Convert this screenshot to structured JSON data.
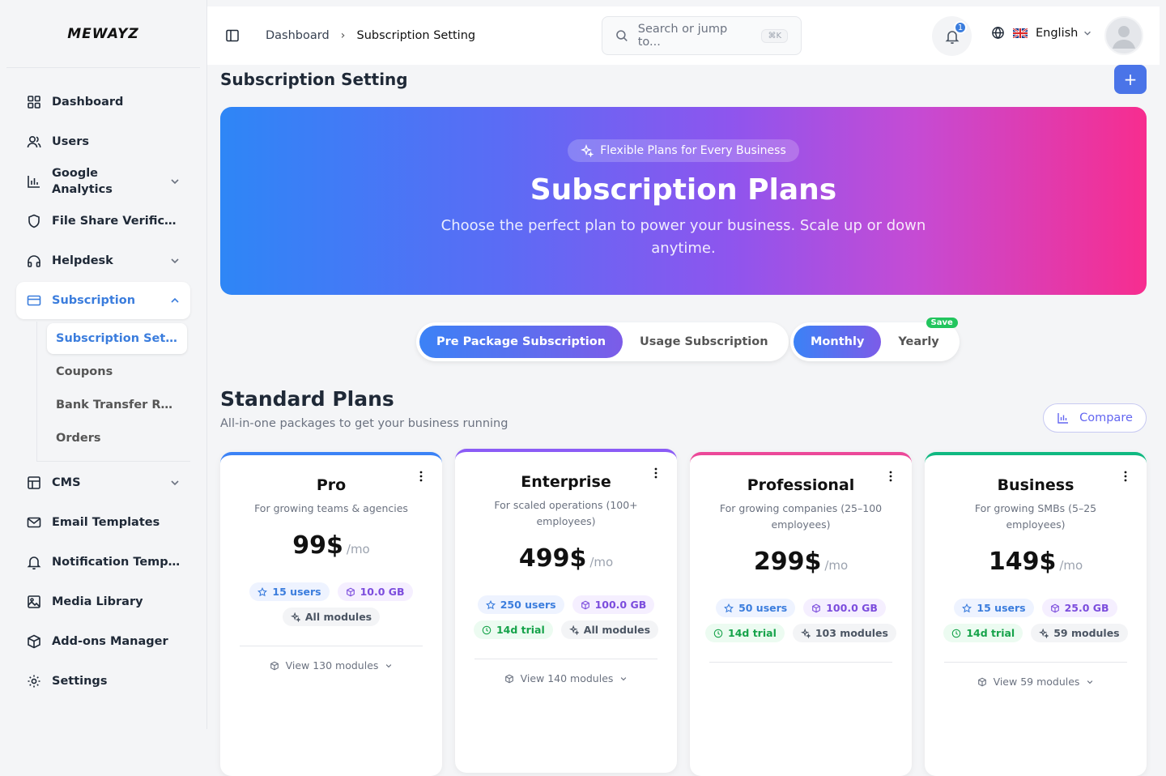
{
  "brand": {
    "logo": "MEWAYZ"
  },
  "sidebar": {
    "items": [
      {
        "label": "Dashboard"
      },
      {
        "label": "Users"
      },
      {
        "label": "Google Analytics"
      },
      {
        "label": "File Share Verifica..."
      },
      {
        "label": "Helpdesk"
      },
      {
        "label": "Subscription"
      },
      {
        "label": "CMS"
      },
      {
        "label": "Email Templates"
      },
      {
        "label": "Notification Templ..."
      },
      {
        "label": "Media Library"
      },
      {
        "label": "Add-ons Manager"
      },
      {
        "label": "Settings"
      }
    ],
    "sub_items": [
      {
        "label": "Subscription Sett..."
      },
      {
        "label": "Coupons"
      },
      {
        "label": "Bank Transfer Re..."
      },
      {
        "label": "Orders"
      }
    ]
  },
  "header": {
    "breadcrumb": [
      "Dashboard",
      "Subscription Setting"
    ],
    "search_placeholder": "Search or jump to...",
    "search_shortcut": "⌘K",
    "notification_count": "1",
    "language": "English"
  },
  "page": {
    "title": "Subscription Setting",
    "add_label": "+"
  },
  "hero": {
    "pill": "Flexible Plans for Every Business",
    "title": "Subscription Plans",
    "subtitle": "Choose the perfect plan to power your business. Scale up or down anytime."
  },
  "toggles": {
    "type": [
      "Pre Package Subscription",
      "Usage Subscription"
    ],
    "period": [
      "Monthly",
      "Yearly"
    ],
    "save_badge": "Save"
  },
  "section": {
    "title": "Standard Plans",
    "subtitle": "All-in-one packages to get your business running",
    "compare_label": "Compare"
  },
  "plans": [
    {
      "name": "Pro",
      "desc": "For growing teams & agencies",
      "price": "99$",
      "period": "/mo",
      "users": "15 users",
      "storage": "10.0 GB",
      "trial": "",
      "modules": "All modules",
      "view": "View 130 modules",
      "color": "#3b82f6"
    },
    {
      "name": "Enterprise",
      "desc": "For scaled operations (100+ employees)",
      "price": "499$",
      "period": "/mo",
      "users": "250 users",
      "storage": "100.0 GB",
      "trial": "14d trial",
      "modules": "All modules",
      "view": "View 140 modules",
      "color": "#8b5cf6"
    },
    {
      "name": "Professional",
      "desc": "For growing companies (25–100 employees)",
      "price": "299$",
      "period": "/mo",
      "users": "50 users",
      "storage": "100.0 GB",
      "trial": "14d trial",
      "modules": "103 modules",
      "view": "",
      "color": "#ec4899"
    },
    {
      "name": "Business",
      "desc": "For growing SMBs (5–25 employees)",
      "price": "149$",
      "period": "/mo",
      "users": "15 users",
      "storage": "25.0 GB",
      "trial": "14d trial",
      "modules": "59 modules",
      "view": "View 59 modules",
      "color": "#10b981"
    }
  ]
}
